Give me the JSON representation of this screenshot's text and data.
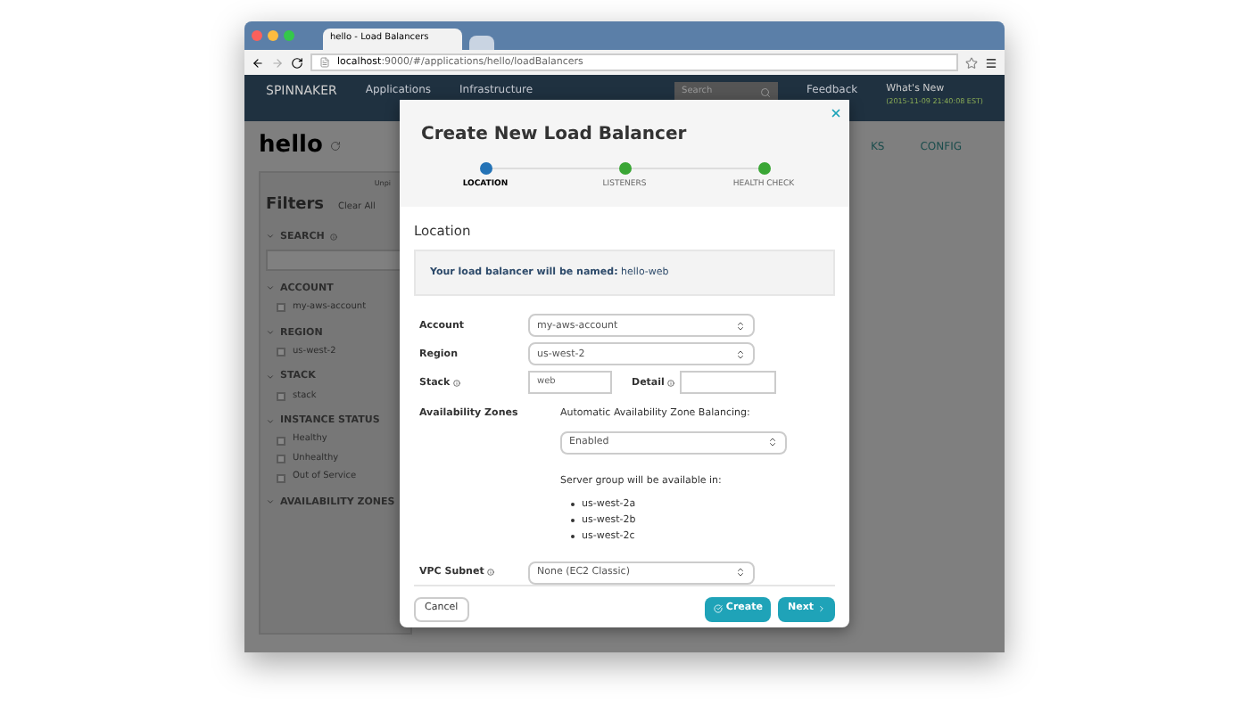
{
  "browser": {
    "tab_title": "hello - Load Balancers",
    "url_host": "localhost",
    "url_rest": ":9000/#/applications/hello/loadBalancers"
  },
  "nav": {
    "brand": "SPINNAKER",
    "items": [
      "Applications",
      "Infrastructure"
    ],
    "search_placeholder": "Search",
    "feedback": "Feedback",
    "whats_new": "What's New",
    "version": "(2015-11-09 21:40:08 EST)"
  },
  "app": {
    "name": "hello",
    "tabs": [
      "KS",
      "CONFIG"
    ]
  },
  "filters": {
    "title": "Filters",
    "clear_all": "Clear All",
    "unpin": "Unpi",
    "sections": [
      {
        "label": "SEARCH",
        "info": true,
        "kind": "search"
      },
      {
        "label": "ACCOUNT",
        "info": false,
        "kind": "checkboxes",
        "options": [
          {
            "label": "my-aws-account",
            "checked": false
          }
        ]
      },
      {
        "label": "REGION",
        "info": false,
        "kind": "checkboxes",
        "options": [
          {
            "label": "us-west-2",
            "checked": false
          }
        ]
      },
      {
        "label": "STACK",
        "info": false,
        "kind": "checkboxes",
        "options": [
          {
            "label": "stack",
            "checked": false
          }
        ]
      },
      {
        "label": "INSTANCE STATUS",
        "info": false,
        "kind": "checkboxes",
        "options": [
          {
            "label": "Healthy",
            "checked": false
          },
          {
            "label": "Unhealthy",
            "checked": false
          },
          {
            "label": "Out of Service",
            "checked": false
          }
        ]
      },
      {
        "label": "AVAILABILITY ZONES",
        "info": false,
        "kind": "checkboxes"
      }
    ]
  },
  "modal": {
    "title": "Create New Load Balancer",
    "steps": [
      {
        "label": "LOCATION",
        "selected": true
      },
      {
        "label": "LISTENERS",
        "selected": false
      },
      {
        "label": "HEALTH CHECK",
        "selected": false
      }
    ],
    "section": "Location",
    "notice_label": "Your load balancer will be named:",
    "notice_value": "hello-web",
    "account": {
      "label": "Account",
      "value": "my-aws-account"
    },
    "region": {
      "label": "Region",
      "value": "us-west-2"
    },
    "stack": {
      "label": "Stack",
      "value": "web"
    },
    "detail": {
      "label": "Detail"
    },
    "zones": {
      "label": "Availability Zones",
      "balancing_label": "Automatic Availability Zone Balancing:",
      "balancing_value": "Enabled",
      "available_label": "Server group will be available in:",
      "zones": [
        "us-west-2a",
        "us-west-2b",
        "us-west-2c"
      ]
    },
    "subnet": {
      "label": "VPC Subnet",
      "value": "None (EC2 Classic)"
    },
    "cancel": "Cancel",
    "create": "Create",
    "next": "Next"
  }
}
